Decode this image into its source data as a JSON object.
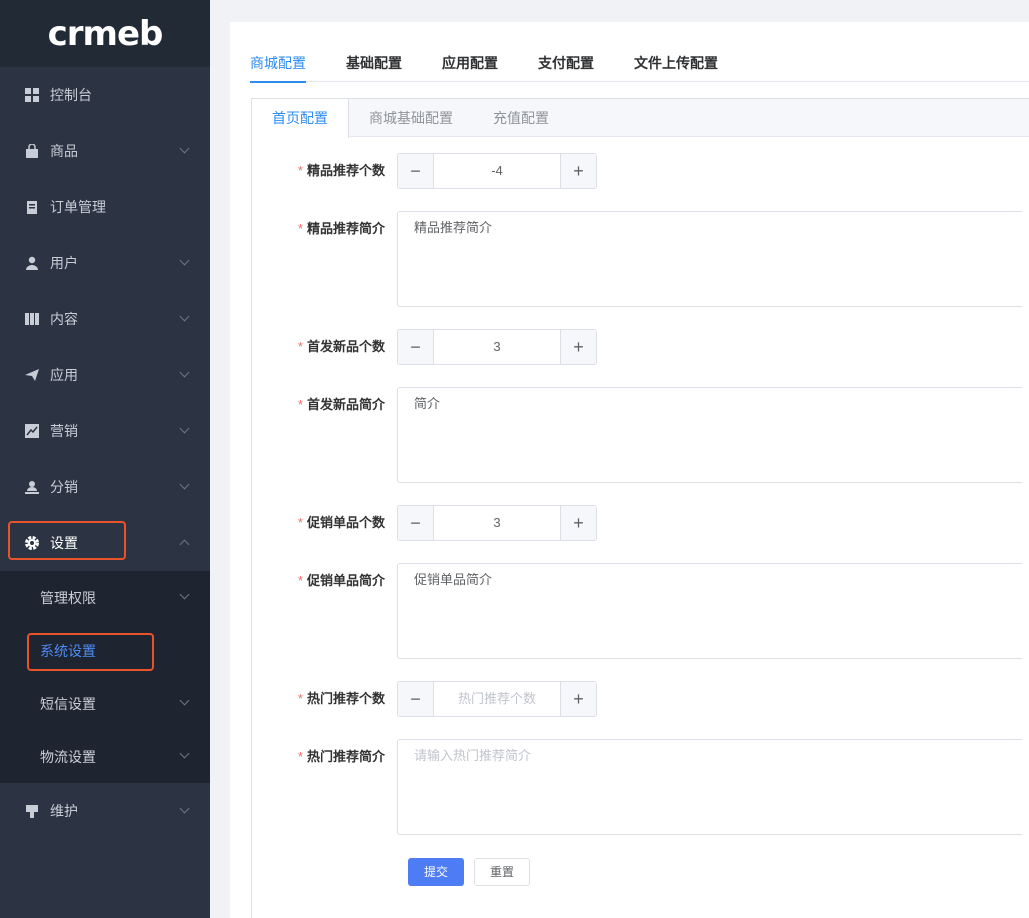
{
  "logo": {
    "text": "crmeb"
  },
  "sidebar": {
    "items": [
      {
        "label": "控制台",
        "icon": "dashboard-icon"
      },
      {
        "label": "商品",
        "icon": "shopping-bag-icon"
      },
      {
        "label": "订单管理",
        "icon": "clipboard-icon"
      },
      {
        "label": "用户",
        "icon": "user-icon"
      },
      {
        "label": "内容",
        "icon": "book-icon"
      },
      {
        "label": "应用",
        "icon": "paper-plane-icon"
      },
      {
        "label": "营销",
        "icon": "chart-icon"
      },
      {
        "label": "分销",
        "icon": "distribution-user-icon"
      },
      {
        "label": "设置",
        "icon": "gear-icon"
      },
      {
        "label": "维护",
        "icon": "maintenance-icon"
      }
    ],
    "settings_sub": [
      {
        "label": "管理权限"
      },
      {
        "label": "系统设置"
      },
      {
        "label": "短信设置"
      },
      {
        "label": "物流设置"
      }
    ]
  },
  "top_tabs": [
    "商城配置",
    "基础配置",
    "应用配置",
    "支付配置",
    "文件上传配置"
  ],
  "sub_tabs": [
    "首页配置",
    "商城基础配置",
    "充值配置"
  ],
  "form": {
    "required_mark": "*",
    "fields": [
      {
        "label": "精品推荐个数",
        "value": "-4"
      },
      {
        "label": "精品推荐简介",
        "value": "精品推荐简介"
      },
      {
        "label": "首发新品个数",
        "value": "3"
      },
      {
        "label": "首发新品简介",
        "value": "简介"
      },
      {
        "label": "促销单品个数",
        "value": "3"
      },
      {
        "label": "促销单品简介",
        "value": "促销单品简介"
      },
      {
        "label": "热门推荐个数",
        "placeholder": "热门推荐个数"
      },
      {
        "label": "热门推荐简介",
        "placeholder": "请输入热门推荐简介"
      }
    ],
    "minus_symbol": "−",
    "plus_symbol": "+",
    "submit_label": "提交",
    "reset_label": "重置"
  },
  "colors": {
    "sidebar_bg": "#2c3443",
    "primary": "#4d7cf5",
    "highlight": "#e8532a"
  }
}
